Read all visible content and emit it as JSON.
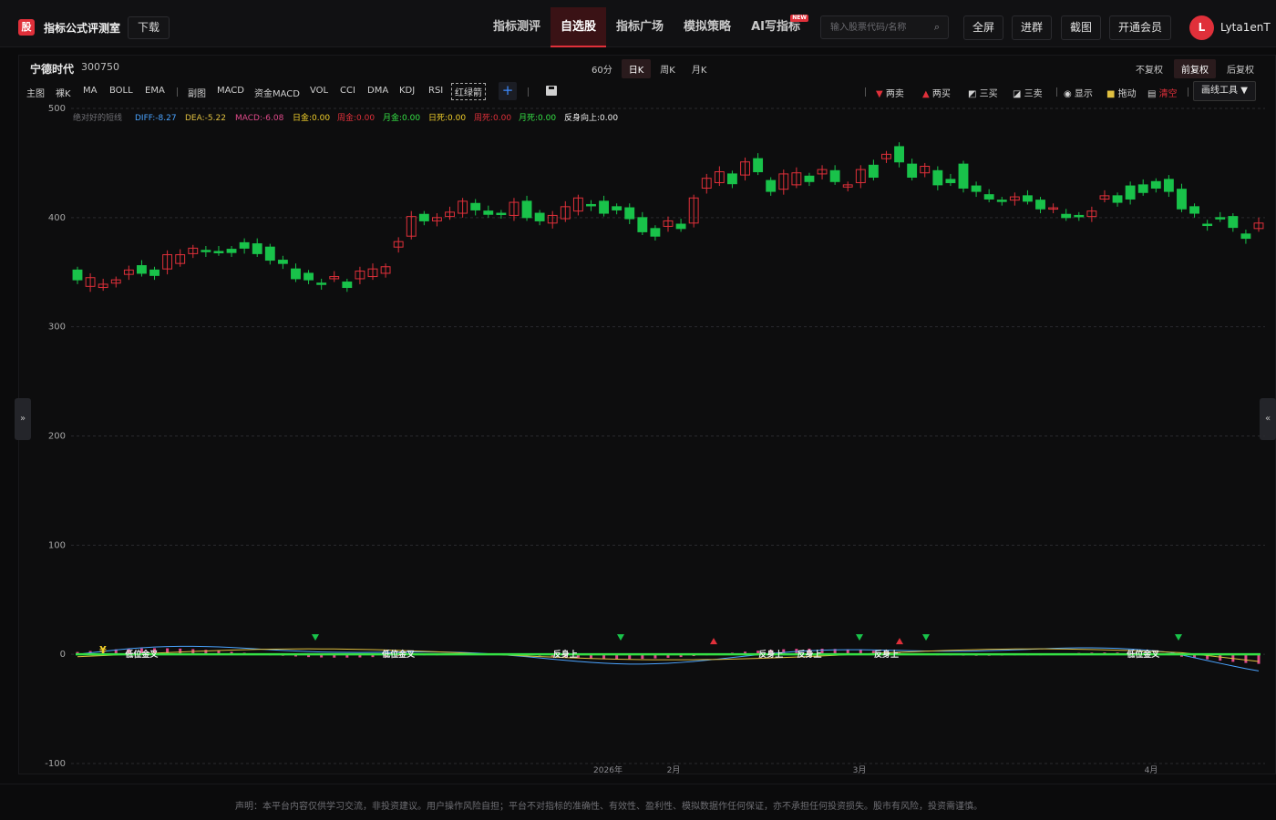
{
  "app": {
    "logo_char": "股",
    "brand": "指标公式评测室",
    "download": "下载"
  },
  "nav": [
    "指标测评",
    "自选股",
    "指标广场",
    "模拟策略",
    "AI写指标"
  ],
  "nav_new_badge": "NEW",
  "search": {
    "placeholder": "输入股票代码/名称",
    "icon": "search-icon"
  },
  "top_buttons": [
    "全屏",
    "进群",
    "截图",
    "开通会员"
  ],
  "user": {
    "initial": "L",
    "name": "Lyta1enT"
  },
  "stock": {
    "name": "宁德时代",
    "code": "300750"
  },
  "periods": [
    "60分",
    "日K",
    "周K",
    "月K"
  ],
  "active_period": "日K",
  "adjust": [
    "不复权",
    "前复权",
    "后复权"
  ],
  "active_adjust": "前复权",
  "indicators_main": [
    "主图",
    "裸K",
    "MA",
    "BOLL",
    "EMA"
  ],
  "indicators_sub": [
    "副图",
    "MACD",
    "资金MACD",
    "VOL",
    "CCI",
    "DMA",
    "KDJ",
    "RSI"
  ],
  "indicator_selected": "红绿箭",
  "right_tools": {
    "two_sell": "两卖",
    "two_buy": "两买",
    "three_buy": "三买",
    "three_sell": "三卖",
    "show": "显示",
    "drag": "拖动",
    "clear": "清空",
    "draw_tool": "画线工具"
  },
  "legend": {
    "name": "绝对好的短线",
    "diff": "DIFF:-8.27",
    "dea": "DEA:-5.22",
    "macd": "MACD:-6.08",
    "day_gold": "日金:0.00",
    "week_gold": "周金:0.00",
    "month_gold": "月金:0.00",
    "day_death": "日死:0.00",
    "week_death": "周死:0.00",
    "month_death": "月死:0.00",
    "reverse_up": "反身向上:0.00"
  },
  "colors": {
    "up": "#e0303a",
    "down": "#19c24a",
    "diff": "#4aa3ff",
    "dea": "#e0c040",
    "macd": "#e04a8a",
    "zero_line": "#35e045",
    "grid": "#2a2a2e",
    "background": "#0d0d0e",
    "accent": "#e0303a"
  },
  "chart_data": {
    "type": "candlestick",
    "y_axis": {
      "min": -100,
      "max": 500,
      "ticks": [
        500,
        400,
        300,
        200,
        100,
        0,
        -100
      ]
    },
    "x_labels": [
      "2026年",
      "2月",
      "3月",
      "4月"
    ],
    "candles": [
      [
        352,
        343
      ],
      [
        337,
        345
      ],
      [
        336,
        339
      ],
      [
        340,
        343
      ],
      [
        348,
        352
      ],
      [
        356,
        349
      ],
      [
        352,
        347
      ],
      [
        353,
        366
      ],
      [
        358,
        366
      ],
      [
        367,
        372
      ],
      [
        370,
        369
      ],
      [
        369,
        368
      ],
      [
        371,
        368
      ],
      [
        377,
        372
      ],
      [
        376,
        367
      ],
      [
        373,
        361
      ],
      [
        361,
        358
      ],
      [
        353,
        344
      ],
      [
        349,
        343
      ],
      [
        340,
        339
      ],
      [
        344,
        346
      ],
      [
        341,
        336
      ],
      [
        344,
        351
      ],
      [
        346,
        353
      ],
      [
        349,
        355
      ],
      [
        373,
        378
      ],
      [
        383,
        401
      ],
      [
        403,
        397
      ],
      [
        397,
        400
      ],
      [
        401,
        405
      ],
      [
        404,
        415
      ],
      [
        413,
        407
      ],
      [
        406,
        403
      ],
      [
        404,
        403
      ],
      [
        402,
        414
      ],
      [
        415,
        400
      ],
      [
        404,
        397
      ],
      [
        395,
        402
      ],
      [
        399,
        410
      ],
      [
        406,
        418
      ],
      [
        412,
        411
      ],
      [
        415,
        404
      ],
      [
        410,
        407
      ],
      [
        409,
        399
      ],
      [
        400,
        387
      ],
      [
        390,
        383
      ],
      [
        392,
        397
      ],
      [
        394,
        390
      ],
      [
        395,
        418
      ],
      [
        427,
        436
      ],
      [
        432,
        442
      ],
      [
        440,
        431
      ],
      [
        439,
        451
      ],
      [
        454,
        442
      ],
      [
        434,
        424
      ],
      [
        426,
        440
      ],
      [
        430,
        441
      ],
      [
        438,
        433
      ],
      [
        440,
        444
      ],
      [
        443,
        433
      ],
      [
        428,
        430
      ],
      [
        432,
        444
      ],
      [
        448,
        437
      ],
      [
        454,
        458
      ],
      [
        465,
        451
      ],
      [
        449,
        437
      ],
      [
        441,
        447
      ],
      [
        443,
        430
      ],
      [
        435,
        432
      ],
      [
        449,
        427
      ],
      [
        429,
        424
      ],
      [
        421,
        417
      ],
      [
        416,
        415
      ],
      [
        416,
        419
      ],
      [
        420,
        415
      ],
      [
        416,
        408
      ],
      [
        409,
        409
      ],
      [
        403,
        400
      ],
      [
        402,
        401
      ],
      [
        401,
        406
      ],
      [
        417,
        420
      ],
      [
        420,
        414
      ],
      [
        429,
        417
      ],
      [
        430,
        423
      ],
      [
        433,
        427
      ],
      [
        435,
        424
      ],
      [
        426,
        408
      ],
      [
        410,
        404
      ],
      [
        394,
        393
      ],
      [
        400,
        399
      ],
      [
        401,
        391
      ],
      [
        385,
        381
      ],
      [
        390,
        395
      ]
    ],
    "markers": [
      {
        "type": "low-gold-cross",
        "label": "低位金叉",
        "index": 5
      },
      {
        "type": "low-gold-cross",
        "label": "低位金叉",
        "index": 25
      },
      {
        "type": "reverse-up",
        "label": "反身上",
        "index": 38
      },
      {
        "type": "reverse-up",
        "label": "反身上",
        "index": 54
      },
      {
        "type": "reverse-up",
        "label": "反身上",
        "index": 57
      },
      {
        "type": "reverse-up",
        "label": "反身上",
        "index": 63
      },
      {
        "type": "low-gold-cross",
        "label": "低位金叉",
        "index": 83
      }
    ],
    "yen_label": "¥"
  },
  "footer": "声明：本平台内容仅供学习交流，非投资建议。用户操作风险自担；平台不对指标的准确性、有效性、盈利性、模拟数据作任何保证，亦不承担任何投资损失。股市有风险，投资需谨慎。"
}
